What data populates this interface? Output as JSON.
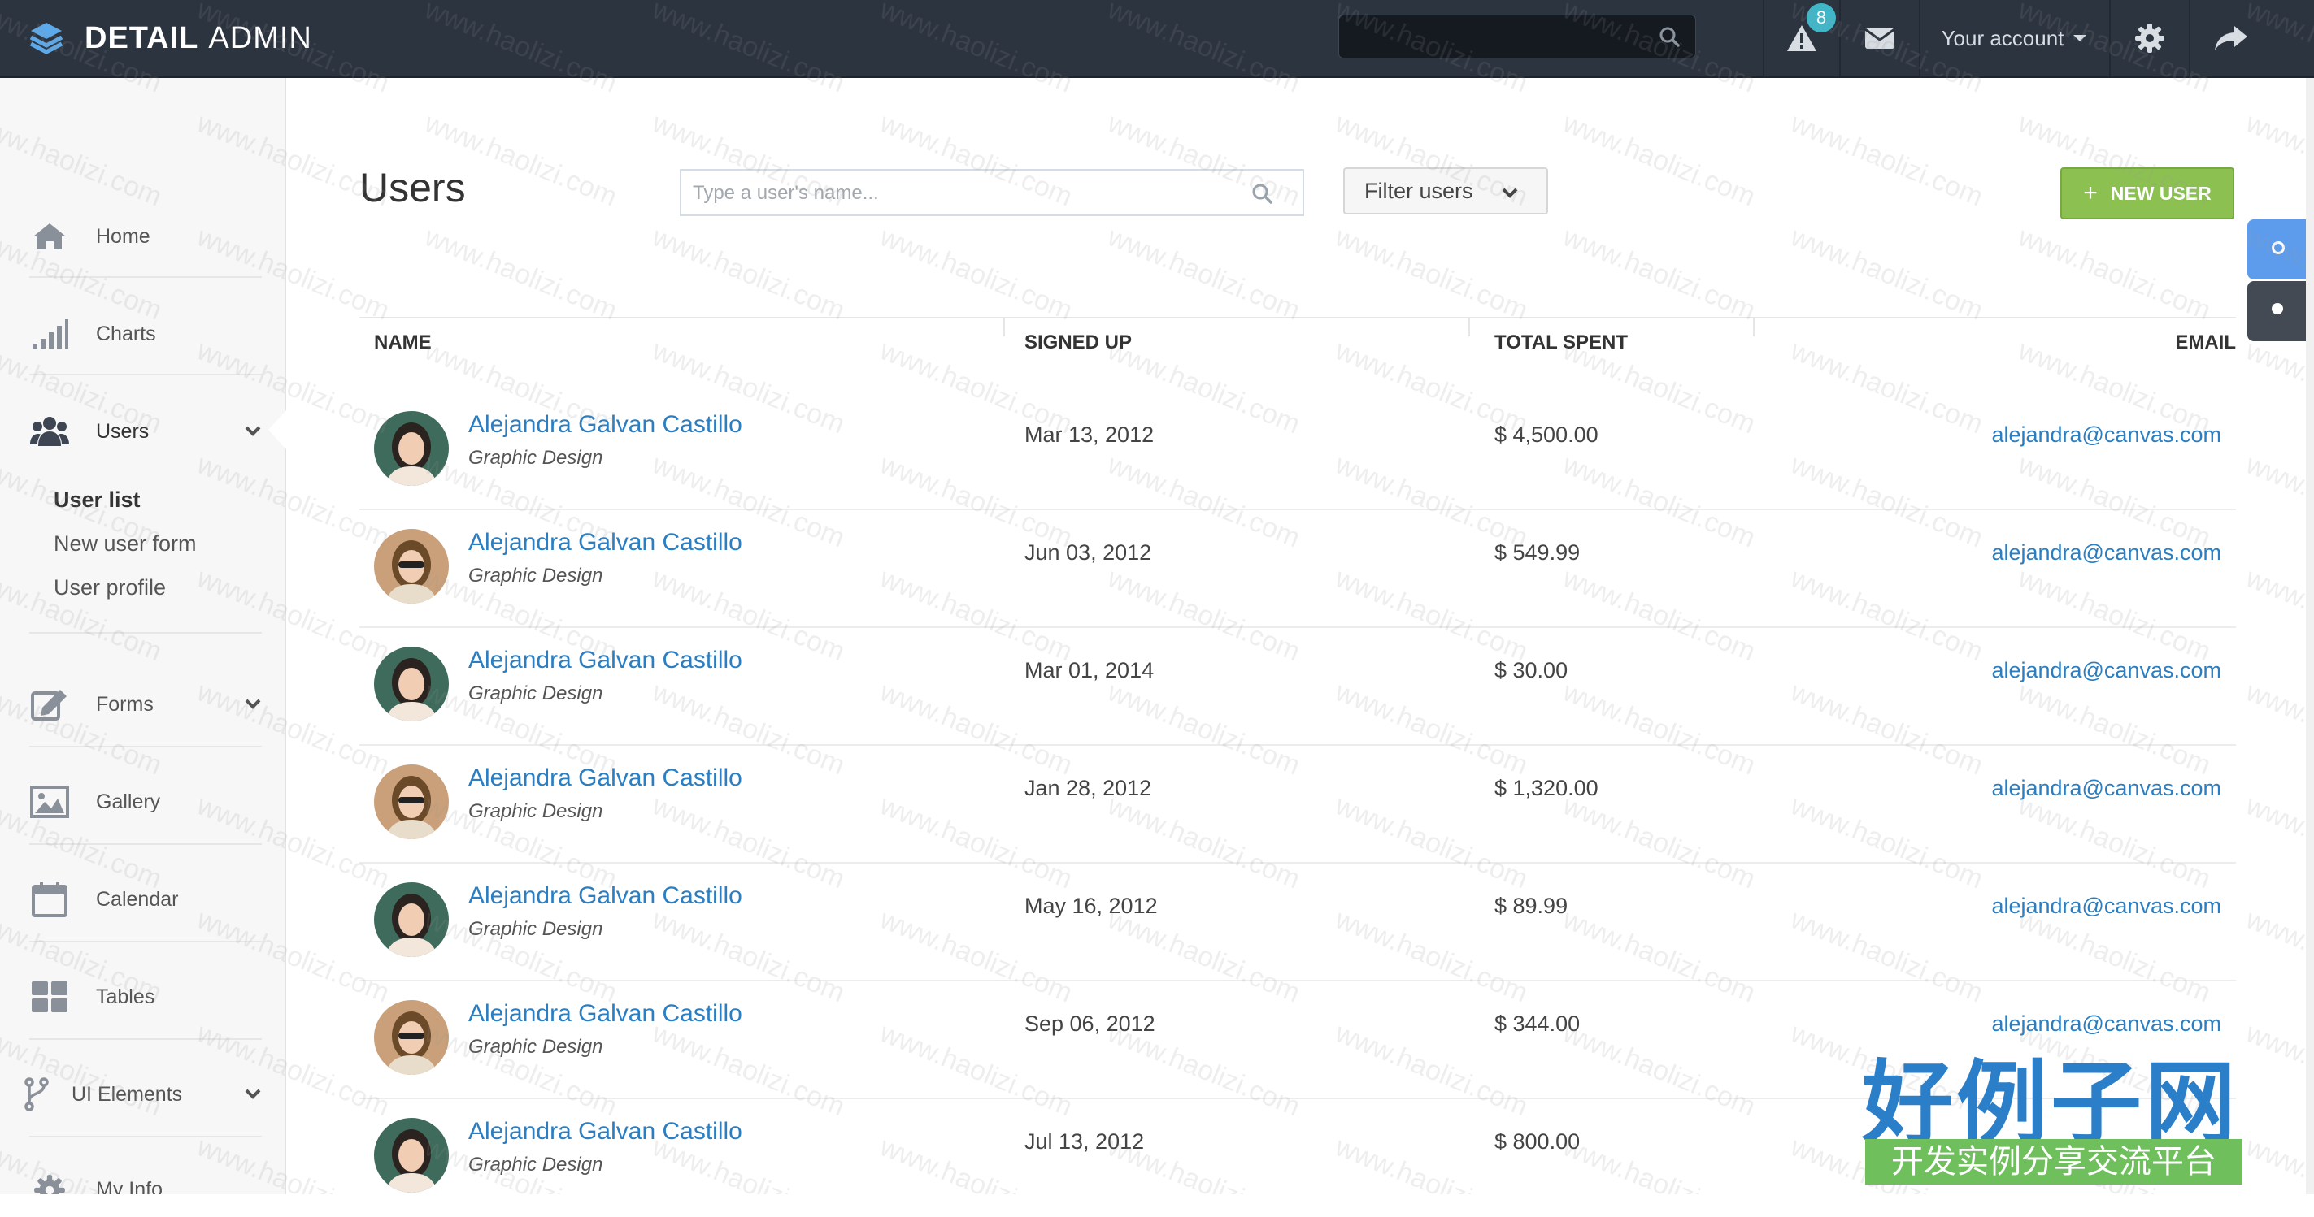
{
  "brand": {
    "bold": "DETAIL",
    "light": "ADMIN"
  },
  "topbar": {
    "search_placeholder": "",
    "alerts_badge": "8",
    "account_label": "Your account"
  },
  "sidebar": {
    "items": [
      {
        "label": "Home",
        "icon": "home-icon"
      },
      {
        "label": "Charts",
        "icon": "bar-chart-icon"
      },
      {
        "label": "Users",
        "icon": "users-icon"
      },
      {
        "label": "Forms",
        "icon": "edit-icon"
      },
      {
        "label": "Gallery",
        "icon": "picture-icon"
      },
      {
        "label": "Calendar",
        "icon": "calendar-icon"
      },
      {
        "label": "Tables",
        "icon": "tables-icon"
      },
      {
        "label": "UI Elements",
        "icon": "code-fork-icon"
      },
      {
        "label": "My Info",
        "icon": "gear-icon"
      }
    ],
    "users_sub": [
      "User list",
      "New user form",
      "User profile"
    ]
  },
  "page": {
    "title": "Users",
    "search_placeholder": "Type a user's name...",
    "filter_label": "Filter users",
    "new_user_label": "NEW USER"
  },
  "table": {
    "headers": [
      "NAME",
      "SIGNED UP",
      "TOTAL SPENT",
      "EMAIL"
    ],
    "rows": [
      {
        "name": "Alejandra Galvan Castillo",
        "role": "Graphic Design",
        "signed": "Mar 13, 2012",
        "spent": "$ 4,500.00",
        "email": "alejandra@canvas.com",
        "avatar": "green"
      },
      {
        "name": "Alejandra Galvan Castillo",
        "role": "Graphic Design",
        "signed": "Jun 03, 2012",
        "spent": "$ 549.99",
        "email": "alejandra@canvas.com",
        "avatar": "sunglasses"
      },
      {
        "name": "Alejandra Galvan Castillo",
        "role": "Graphic Design",
        "signed": "Mar 01, 2014",
        "spent": "$ 30.00",
        "email": "alejandra@canvas.com",
        "avatar": "green"
      },
      {
        "name": "Alejandra Galvan Castillo",
        "role": "Graphic Design",
        "signed": "Jan 28, 2012",
        "spent": "$ 1,320.00",
        "email": "alejandra@canvas.com",
        "avatar": "sunglasses"
      },
      {
        "name": "Alejandra Galvan Castillo",
        "role": "Graphic Design",
        "signed": "May 16, 2012",
        "spent": "$ 89.99",
        "email": "alejandra@canvas.com",
        "avatar": "green"
      },
      {
        "name": "Alejandra Galvan Castillo",
        "role": "Graphic Design",
        "signed": "Sep 06, 2012",
        "spent": "$ 344.00",
        "email": "alejandra@canvas.com",
        "avatar": "sunglasses"
      },
      {
        "name": "Alejandra Galvan Castillo",
        "role": "Graphic Design",
        "signed": "Jul 13, 2012",
        "spent": "$ 800.00",
        "email": "",
        "avatar": "green"
      }
    ]
  },
  "watermark": {
    "logo_text": "好例子网",
    "tagline": "开发实例分享交流平台",
    "diagonal_text": "www.haolizi.com"
  },
  "colors": {
    "topbar": "#2c3440",
    "accent_blue": "#2a7ec1",
    "new_user_green": "#8cc152",
    "badge": "#3fb7c9",
    "side_tab_light": "#5d9cec",
    "side_tab_dark": "#434a54"
  }
}
